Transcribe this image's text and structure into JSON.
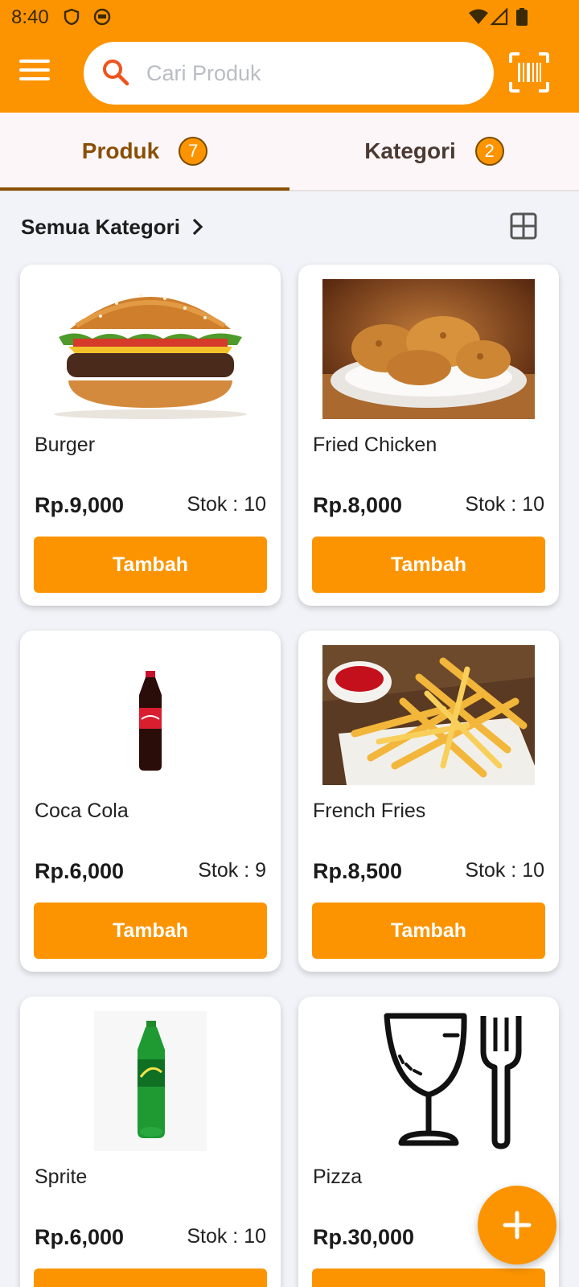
{
  "status_bar": {
    "time": "8:40"
  },
  "search": {
    "placeholder": "Cari Produk"
  },
  "tabs": [
    {
      "label": "Produk",
      "count": "7",
      "active": true
    },
    {
      "label": "Kategori",
      "count": "2",
      "active": false
    }
  ],
  "category_filter": {
    "label": "Semua Kategori"
  },
  "products": [
    {
      "name": "Burger",
      "price": "Rp.9,000",
      "stock": "Stok : 10",
      "button": "Tambah",
      "image": "burger"
    },
    {
      "name": "Fried Chicken",
      "price": "Rp.8,000",
      "stock": "Stok : 10",
      "button": "Tambah",
      "image": "fried-chicken"
    },
    {
      "name": "Coca Cola",
      "price": "Rp.6,000",
      "stock": "Stok : 9",
      "button": "Tambah",
      "image": "cola-bottle"
    },
    {
      "name": "French Fries",
      "price": "Rp.8,500",
      "stock": "Stok : 10",
      "button": "Tambah",
      "image": "french-fries"
    },
    {
      "name": "Sprite",
      "price": "Rp.6,000",
      "stock": "Stok : 10",
      "button": "Tambah",
      "image": "sprite-bottle"
    },
    {
      "name": "Pizza",
      "price": "Rp.30,000",
      "stock": "St",
      "button": "",
      "image": "glass-fork-placeholder"
    }
  ],
  "colors": {
    "primary": "#fb9400",
    "tab_active": "#8a4f05",
    "background": "#f1f3f8"
  },
  "fab": {
    "icon": "plus-icon"
  }
}
